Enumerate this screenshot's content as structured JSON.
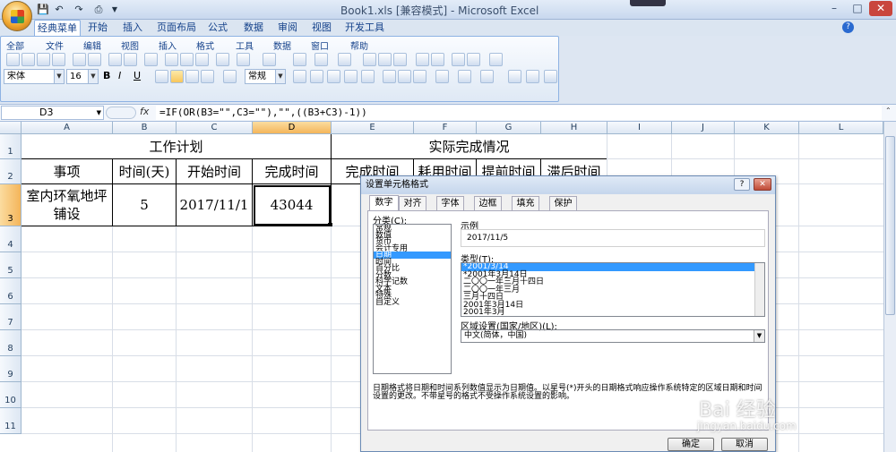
{
  "window": {
    "title": "Book1.xls [兼容模式] - Microsoft Excel",
    "qat_icons": [
      "save-icon",
      "undo-icon",
      "redo-icon",
      "customize-icon"
    ],
    "controls": [
      "–",
      "□",
      "✕"
    ]
  },
  "ribbon_tabs": [
    "经典菜单",
    "开始",
    "插入",
    "页面布局",
    "公式",
    "数据",
    "审阅",
    "视图",
    "开发工具"
  ],
  "menu_bar": [
    "全部",
    "文件",
    "编辑",
    "视图",
    "插入",
    "格式",
    "工具",
    "数据",
    "窗口",
    "帮助"
  ],
  "toolbar": {
    "font_name": "宋体",
    "font_size": "16",
    "number_format": "常规"
  },
  "formula_bar": {
    "name_box": "D3",
    "fx_label": "fx",
    "formula": "=IF(OR(B3=\"\",C3=\"\"),\"\",((B3+C3)-1))"
  },
  "columns": [
    "A",
    "B",
    "C",
    "D",
    "E",
    "F",
    "G",
    "H",
    "I",
    "J",
    "K",
    "L"
  ],
  "rows": [
    "1",
    "2",
    "3",
    "4",
    "5",
    "6",
    "7",
    "8",
    "9",
    "10",
    "11"
  ],
  "sheet": {
    "header_left": "工作计划",
    "header_right": "实际完成情况",
    "h_item": "事项",
    "h_time": "时间(天)",
    "h_start": "开始时间",
    "h_finish": "完成时间",
    "h_actual_finish": "完成时间",
    "h_used": "耗用时间",
    "h_early": "提前时间",
    "h_late": "滞后时间",
    "r3_item": "室内环氧地坪铺设",
    "r3_time": "5",
    "r3_start": "2017/11/1",
    "r3_finish": "43044"
  },
  "dialog": {
    "title": "设置单元格格式",
    "help": "?",
    "close": "✕",
    "tabs": [
      "数字",
      "对齐",
      "字体",
      "边框",
      "填充",
      "保护"
    ],
    "category_label": "分类(C):",
    "categories": [
      "常规",
      "数值",
      "货币",
      "会计专用",
      "日期",
      "时间",
      "百分比",
      "分数",
      "科学记数",
      "文本",
      "特殊",
      "自定义"
    ],
    "selected_category": "日期",
    "sample_label": "示例",
    "sample_value": "2017/11/5",
    "type_label": "类型(T):",
    "types": [
      "*2001/3/14",
      "*2001年3月14日",
      "二〇〇一年三月十四日",
      "二〇〇一年三月",
      "三月十四日",
      "2001年3月14日",
      "2001年3月"
    ],
    "locale_label": "区域设置(国家/地区)(L):",
    "locale_value": "中文(简体，中国)",
    "description": "日期格式将日期和时间系列数值显示为日期值。以星号(*)开头的日期格式响应操作系统特定的区域日期和时间设置的更改。不带星号的格式不受操作系统设置的影响。",
    "ok": "确定",
    "cancel": "取消"
  },
  "watermark": {
    "main": "Bai 经验",
    "sub": "jingyan.baidu.com"
  }
}
